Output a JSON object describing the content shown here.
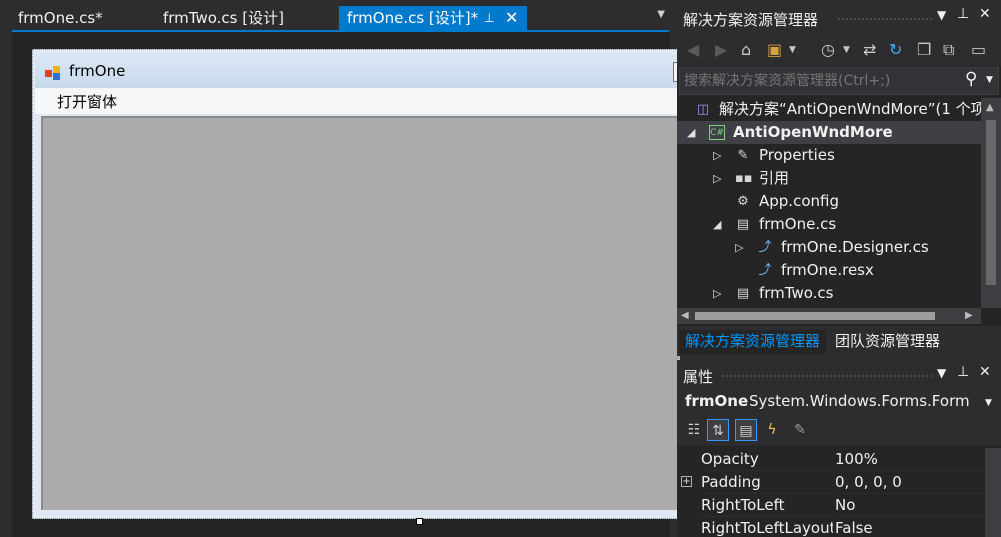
{
  "tabs": [
    {
      "label": "frmOne.cs*",
      "active": false
    },
    {
      "label": "frmTwo.cs [设计]",
      "active": false
    },
    {
      "label": "frmOne.cs [设计]*",
      "active": true
    }
  ],
  "tab_pin_glyph": "⊥",
  "tab_close_glyph": "✕",
  "designer": {
    "form_title": "frmOne",
    "menu_item": "打开窗体"
  },
  "solution_explorer": {
    "title": "解决方案资源管理器",
    "search_placeholder": "搜索解决方案资源管理器(Ctrl+;)",
    "tree": [
      {
        "label": "解决方案“AntiOpenWndMore”(1 个项",
        "indent": 0,
        "arrow": "",
        "icon": "solution-icon",
        "bold": false,
        "selected": false
      },
      {
        "label": "AntiOpenWndMore",
        "indent": 0,
        "arrow": "◢",
        "icon": "csharp-project-icon",
        "bold": true,
        "selected": true
      },
      {
        "label": "Properties",
        "indent": 1,
        "arrow": "▷",
        "icon": "wrench-icon",
        "bold": false,
        "selected": false
      },
      {
        "label": "引用",
        "indent": 1,
        "arrow": "▷",
        "icon": "references-icon",
        "bold": false,
        "selected": false
      },
      {
        "label": "App.config",
        "indent": 1,
        "arrow": "",
        "icon": "config-file-icon",
        "bold": false,
        "selected": false
      },
      {
        "label": "frmOne.cs",
        "indent": 1,
        "arrow": "◢",
        "icon": "form-icon",
        "bold": false,
        "selected": false
      },
      {
        "label": "frmOne.Designer.cs",
        "indent": 2,
        "arrow": "▷",
        "icon": "code-file-icon",
        "bold": false,
        "selected": false
      },
      {
        "label": "frmOne.resx",
        "indent": 2,
        "arrow": "",
        "icon": "resx-file-icon",
        "bold": false,
        "selected": false
      },
      {
        "label": "frmTwo.cs",
        "indent": 1,
        "arrow": "▷",
        "icon": "form-icon",
        "bold": false,
        "selected": false
      }
    ]
  },
  "bottom_tabs": [
    {
      "label": "解决方案资源管理器",
      "active": true
    },
    {
      "label": "团队资源管理器",
      "active": false
    }
  ],
  "properties": {
    "title": "属性",
    "object_name": "frmOne",
    "object_type": "System.Windows.Forms.Form",
    "rows": [
      {
        "name": "Opacity",
        "value": "100%",
        "expandable": false
      },
      {
        "name": "Padding",
        "value": "0, 0, 0, 0",
        "expandable": true
      },
      {
        "name": "RightToLeft",
        "value": "No",
        "expandable": false
      },
      {
        "name": "RightToLeftLayout",
        "value": "False",
        "expandable": false
      }
    ]
  },
  "colors": {
    "accent": "#007acc",
    "pane_bg": "#252526",
    "chrome_bg": "#2d2d30",
    "form_client": "#ababab",
    "active_bottom_tab": "#0097fb"
  }
}
